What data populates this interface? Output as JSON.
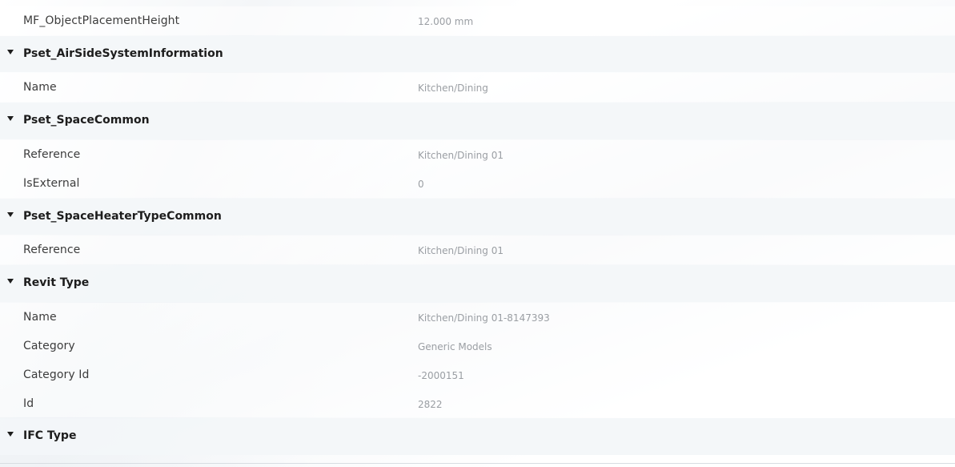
{
  "rows": [
    {
      "kind": "prop",
      "label": "MF_ObjectPlacementHeight",
      "value": "12.000 mm"
    },
    {
      "kind": "group",
      "label": "Pset_AirSideSystemInformation"
    },
    {
      "kind": "prop",
      "label": "Name",
      "value": "Kitchen/Dining"
    },
    {
      "kind": "group",
      "label": "Pset_SpaceCommon"
    },
    {
      "kind": "prop",
      "label": "Reference",
      "value": "Kitchen/Dining 01"
    },
    {
      "kind": "prop",
      "label": "IsExternal",
      "value": "0"
    },
    {
      "kind": "group",
      "label": "Pset_SpaceHeaterTypeCommon"
    },
    {
      "kind": "prop",
      "label": "Reference",
      "value": "Kitchen/Dining 01"
    },
    {
      "kind": "group",
      "label": "Revit Type"
    },
    {
      "kind": "prop",
      "label": "Name",
      "value": "Kitchen/Dining 01-8147393"
    },
    {
      "kind": "prop",
      "label": "Category",
      "value": "Generic Models"
    },
    {
      "kind": "prop",
      "label": "Category Id",
      "value": "-2000151"
    },
    {
      "kind": "prop",
      "label": "Id",
      "value": "2822"
    },
    {
      "kind": "group",
      "label": "IFC Type"
    }
  ],
  "icons": {
    "group_toggle": "caret-down-icon"
  }
}
